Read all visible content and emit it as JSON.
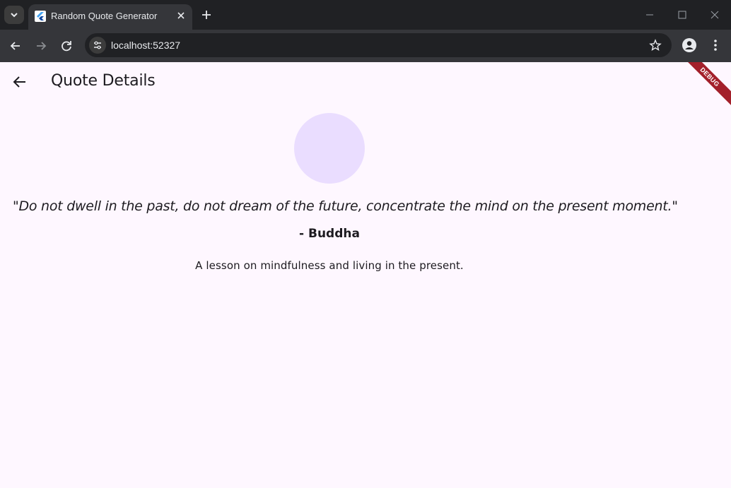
{
  "browser": {
    "tab_title": "Random Quote Generator",
    "url": "localhost:52327"
  },
  "app": {
    "title": "Quote Details",
    "debug_label": "DEBUG",
    "avatar_color": "#eaddff",
    "background": "#fef7ff"
  },
  "quote": {
    "text": "\"Do not dwell in the past, do not dream of the future, concentrate the mind on the present moment.\"",
    "author": "- Buddha",
    "description": "A lesson on mindfulness and living in the present."
  },
  "icons": {
    "tab_search": "chevron-down-icon",
    "favicon": "flutter-icon",
    "tab_close": "close-icon",
    "new_tab": "plus-icon",
    "back": "arrow-back-icon",
    "forward": "arrow-forward-icon",
    "reload": "reload-icon",
    "site_info": "tune-icon",
    "bookmark": "star-icon",
    "profile": "account-icon",
    "menu": "more-vert-icon"
  }
}
